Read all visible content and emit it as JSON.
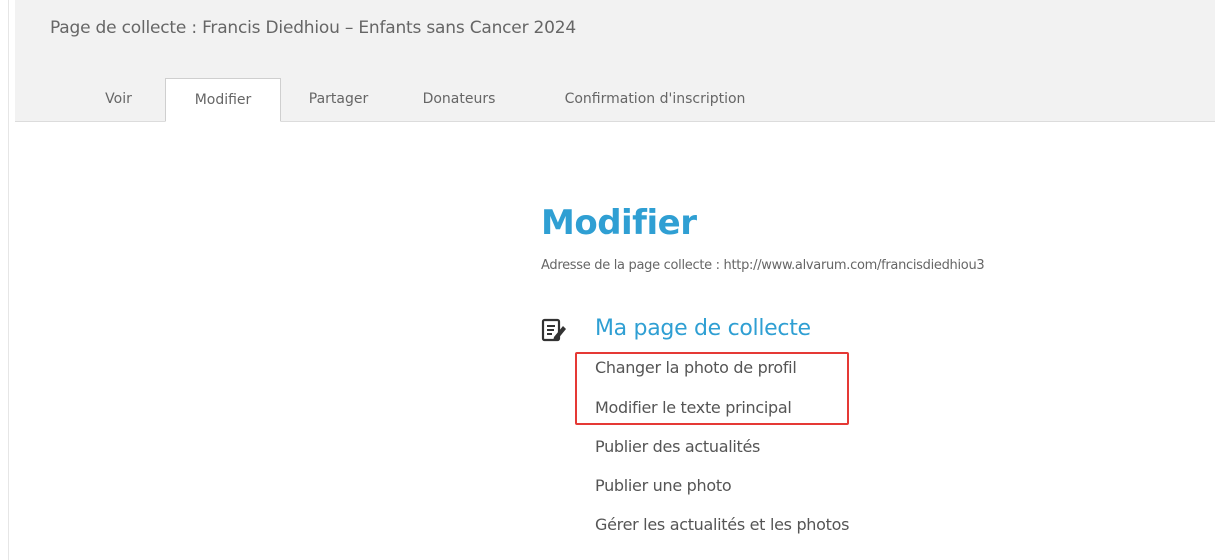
{
  "header": {
    "title": "Page de collecte : Francis Diedhiou – Enfants sans Cancer 2024",
    "tabs": [
      {
        "label": "Voir",
        "active": false
      },
      {
        "label": "Modifier",
        "active": true
      },
      {
        "label": "Partager",
        "active": false
      },
      {
        "label": "Donateurs",
        "active": false
      },
      {
        "label": "Confirmation d'inscription",
        "active": false
      }
    ]
  },
  "main": {
    "title": "Modifier",
    "address_text": "Adresse de la page collecte : http://www.alvarum.com/francisdiedhiou3",
    "section": {
      "icon": "edit-document-icon",
      "title": "Ma page de collecte",
      "items": [
        {
          "label": "Changer la photo de profil",
          "highlighted": true
        },
        {
          "label": "Modifier le texte principal",
          "highlighted": true
        },
        {
          "label": "Publier des actualités",
          "highlighted": false
        },
        {
          "label": "Publier une photo",
          "highlighted": false
        },
        {
          "label": "Gérer les actualités et les photos",
          "highlighted": false
        }
      ]
    }
  },
  "colors": {
    "accent": "#2f9fd3",
    "highlight": "#e53935",
    "header_bg": "#f2f2f2",
    "text": "#555555"
  }
}
